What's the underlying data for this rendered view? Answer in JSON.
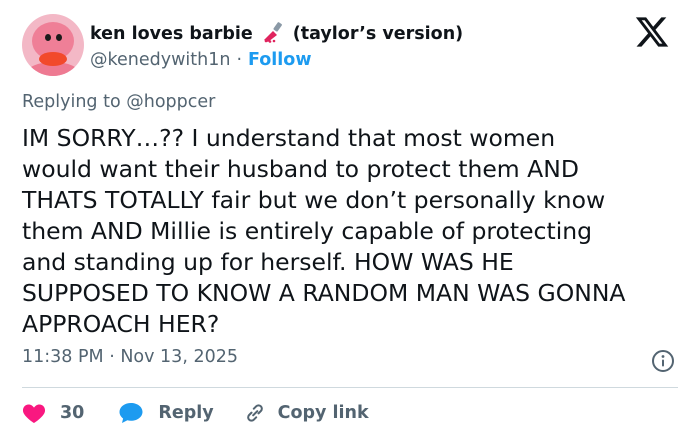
{
  "author": {
    "display_name": "ken loves barbie",
    "name_emoji": "nail-polish-icon",
    "name_suffix": "(taylor’s version)",
    "handle": "@kenedywith1n",
    "separator": "·",
    "follow_label": "Follow"
  },
  "reply_context": {
    "prefix": "Replying to",
    "mention": "@hoppcer"
  },
  "tweet": {
    "lines": [
      "IM SORRY…?? I understand that most women",
      "would want their husband to protect them AND",
      "THATS TOTALLY fair but we don’t personally know",
      "them AND Millie is entirely capable of protecting",
      "and standing up for herself. HOW WAS HE",
      "SUPPOSED TO KNOW A RANDOM MAN WAS GONNA",
      "APPROACH HER?"
    ],
    "timestamp": "11:38 PM · Nov 13, 2025"
  },
  "actions": {
    "like_count": "30",
    "reply_label": "Reply",
    "copy_link_label": "Copy link"
  },
  "icons": [
    "x-logo-icon",
    "info-icon",
    "heart-icon",
    "reply-bubble-icon",
    "link-icon"
  ],
  "colors": {
    "text": "#0f1419",
    "muted": "#536471",
    "link": "#1d9bf0",
    "like": "#f91880",
    "reply_icon": "#1d9bf0",
    "divider": "#cfd9de"
  }
}
